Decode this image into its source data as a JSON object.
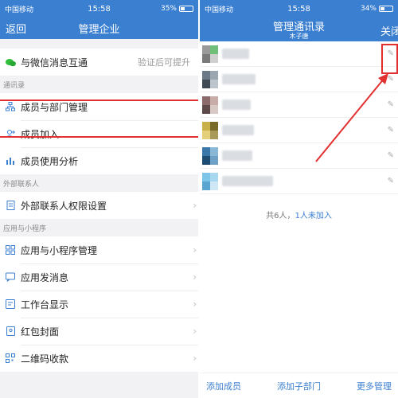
{
  "left": {
    "status": {
      "carrier": "中国移动",
      "time": "15:58",
      "battery": "35%"
    },
    "nav": {
      "back": "返回",
      "title": "管理企业"
    },
    "wechat_row": {
      "label": "与微信消息互通",
      "hint": "验证后可提升"
    },
    "section_contacts": "通讯录",
    "contacts_items": [
      {
        "label": "成员与部门管理",
        "icon": "org-chart-icon"
      },
      {
        "label": "成员加入",
        "icon": "add-user-icon"
      },
      {
        "label": "成员使用分析",
        "icon": "bar-chart-icon"
      }
    ],
    "section_external": "外部联系人",
    "external_items": [
      {
        "label": "外部联系人权限设置",
        "icon": "doc-icon"
      }
    ],
    "section_apps": "应用与小程序",
    "app_items": [
      {
        "label": "应用与小程序管理",
        "icon": "grid-icon"
      },
      {
        "label": "应用发消息",
        "icon": "message-icon"
      },
      {
        "label": "工作台显示",
        "icon": "workbench-icon"
      },
      {
        "label": "红包封面",
        "icon": "red-envelope-icon"
      },
      {
        "label": "二维码收款",
        "icon": "qr-icon"
      }
    ]
  },
  "right": {
    "status": {
      "carrier": "中国移动",
      "time": "15:58",
      "battery": "34%"
    },
    "nav": {
      "title": "管理通讯录",
      "subtitle": "木子唐",
      "close": "关闭"
    },
    "members": [
      {
        "colors": [
          "#9a9a9a",
          "#6fbf7a",
          "#7a7a7a",
          "#cfcfcf"
        ]
      },
      {
        "colors": [
          "#6c7a88",
          "#9aa6b0",
          "#3f4a55",
          "#bcc5cc"
        ]
      },
      {
        "colors": [
          "#8a6a6a",
          "#c7aca8",
          "#5e4a4a",
          "#d8c9c6"
        ]
      },
      {
        "colors": [
          "#c8b04a",
          "#7a6a2a",
          "#e4d07a",
          "#a89a5a"
        ]
      },
      {
        "colors": [
          "#3a77a8",
          "#8ab7d6",
          "#1f4c72",
          "#6fa0c6"
        ]
      },
      {
        "colors": [
          "#7ec3e8",
          "#a8d8f0",
          "#5aa6d0",
          "#cfe8f6"
        ]
      }
    ],
    "summary": {
      "prefix": "共6人，",
      "link": "1人未加入"
    },
    "bottom": {
      "add_member": "添加成员",
      "add_sub_dept": "添加子部门",
      "more": "更多管理"
    }
  }
}
